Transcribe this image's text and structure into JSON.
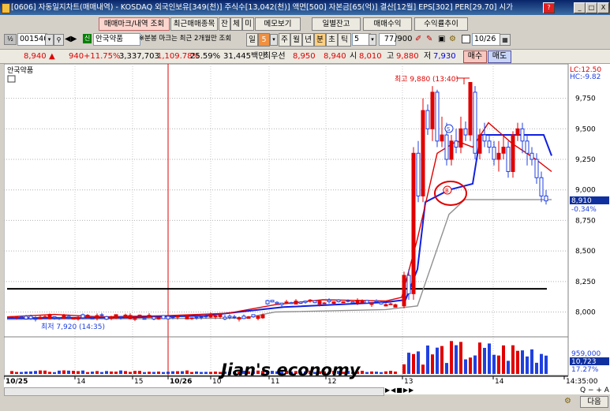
{
  "window": {
    "title": "[0606] 자동일지차트(매매내역) - KOSDAQ 외국인보유[349(천)] 주식수[13,042(천)] 액면[500] 자본금[65(억)] 결산[12월] EPS[302] PER[29.70] 시가",
    "controls": [
      "?",
      "_",
      "□",
      "X"
    ]
  },
  "toolbar1": {
    "buttons": [
      "매매마크/내역 조회",
      "최근매매종목",
      "잔",
      "체",
      "미",
      "메모보기",
      "일별잔고",
      "매매수익",
      "수익률추이"
    ]
  },
  "toolbar2": {
    "code": "001540",
    "stock_name": "안국약품",
    "hint": "※분봉 마크는 최근 2개월만 조회",
    "periods": [
      "일",
      "5",
      "주",
      "월",
      "년",
      "분",
      "초",
      "틱"
    ],
    "interval": "5",
    "count": "77",
    "count_total": "/900",
    "date": "10/26"
  },
  "quote": {
    "price": "8,940",
    "arrow": "▲",
    "change": "940",
    "change_pct": "+11.75%",
    "volume": "3,337,703",
    "volume_pct": "1,109.78%",
    "turnover": "25.59%",
    "amount": "31,445백만",
    "best_label": "최우선",
    "best_price": "8,950",
    "best_price2": "8,940",
    "open_label": "시",
    "open": "8,010",
    "high_label": "고",
    "high": "9,880",
    "low_label": "저",
    "low": "7,930",
    "buy_btn": "매수",
    "sell_btn": "매도"
  },
  "chart": {
    "legend_name": "안국약품",
    "lc": "LC:12.50",
    "hc": "HC:-9.82",
    "high_annot": "최고 9,880 (13:40)",
    "low_annot": "최저 7,920 (14:35)",
    "price_tag": "8,910",
    "price_tag_pct": "-0.34%",
    "vol_tag1": "959,000",
    "vol_tag2": "10,723",
    "vol_tag3": "17.27%",
    "watermark": "Jian's economy",
    "x_labels": [
      "10/25",
      "14",
      "15",
      "10/26",
      "10",
      "11",
      "12",
      "13",
      "14",
      "14:35:00"
    ],
    "y_ticks": [
      "9,750",
      "9,500",
      "9,250",
      "9,000",
      "8,750",
      "8,500",
      "8,250",
      "8,000"
    ],
    "marker_buy": "B",
    "marker_sell": "S"
  },
  "chart_data": {
    "type": "candlestick",
    "title": "",
    "interval": "5분",
    "ylim": [
      7900,
      9980
    ],
    "y_ticks": [
      8000,
      8250,
      8500,
      8750,
      9000,
      9250,
      9500,
      9750
    ],
    "reference_line": 8190,
    "high": {
      "value": 9880,
      "time": "13:40"
    },
    "low": {
      "value": 7920,
      "time": "14:35"
    },
    "last_price": 8910,
    "ma_short": [
      [
        0,
        7960
      ],
      [
        60,
        7980
      ],
      [
        120,
        7960
      ],
      [
        200,
        7970
      ],
      [
        280,
        7990
      ],
      [
        340,
        8060
      ],
      [
        400,
        8100
      ],
      [
        480,
        8090
      ],
      [
        500,
        8120
      ],
      [
        520,
        8600
      ],
      [
        545,
        9300
      ],
      [
        570,
        9400
      ],
      [
        590,
        9350
      ],
      [
        610,
        9550
      ],
      [
        640,
        9380
      ],
      [
        670,
        9250
      ],
      [
        690,
        9150
      ]
    ],
    "ma_long": [
      [
        0,
        7950
      ],
      [
        150,
        7955
      ],
      [
        250,
        7970
      ],
      [
        350,
        8040
      ],
      [
        480,
        8080
      ],
      [
        505,
        8100
      ],
      [
        520,
        8350
      ],
      [
        530,
        8900
      ],
      [
        560,
        9000
      ],
      [
        590,
        9050
      ],
      [
        600,
        9450
      ],
      [
        680,
        9450
      ],
      [
        690,
        9280
      ]
    ],
    "ma_base": [
      [
        0,
        7940
      ],
      [
        300,
        7950
      ],
      [
        340,
        8000
      ],
      [
        480,
        8020
      ],
      [
        520,
        8050
      ],
      [
        560,
        8800
      ],
      [
        580,
        8920
      ],
      [
        690,
        8920
      ]
    ]
  },
  "statusbar": {
    "next": "다음"
  }
}
